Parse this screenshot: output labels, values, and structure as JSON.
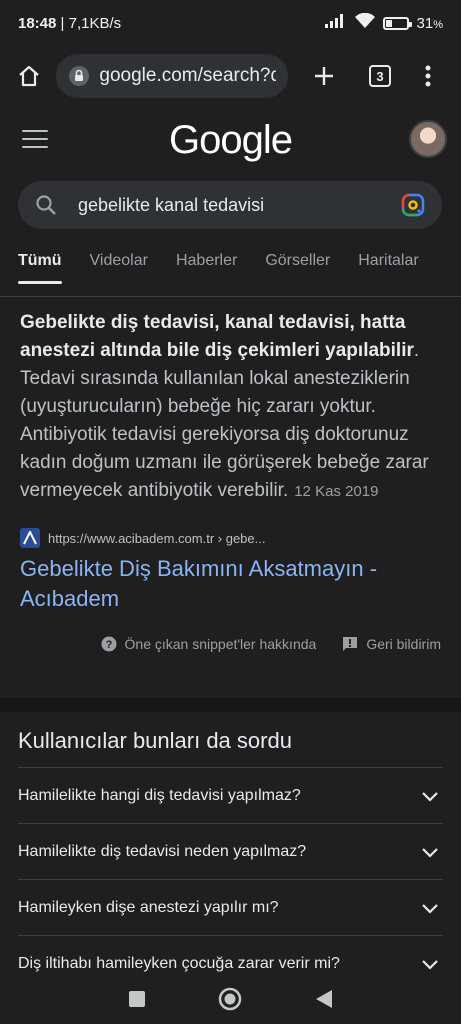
{
  "status_bar": {
    "time": "18:48",
    "speed": "7,1KB/s",
    "separator": " | ",
    "battery_text": "31",
    "battery_level_percent": 31,
    "battery_unit": "%"
  },
  "browser": {
    "url": "google.com/search?q",
    "tab_count": "3"
  },
  "google": {
    "logo_text": "Google"
  },
  "search": {
    "query": "gebelikte kanal tedavisi"
  },
  "filters": [
    {
      "label": "Tümü",
      "active": true
    },
    {
      "label": "Videolar",
      "active": false
    },
    {
      "label": "Haberler",
      "active": false
    },
    {
      "label": "Görseller",
      "active": false
    },
    {
      "label": "Haritalar",
      "active": false
    }
  ],
  "snippet": {
    "bold_text": "Gebelikte diş tedavisi, kanal tedavisi, hatta anestezi altında bile diş çekimleri yapılabilir",
    "body_text": ". Tedavi sırasında kullanılan lokal anesteziklerin (uyuşturucuların) bebeğe hiç zararı yoktur. Antibiyotik tedavisi gerekiyorsa diş doktorunuz kadın doğum uzmanı ile görüşerek bebeğe zarar vermeyecek antibiyotik verebilir.",
    "date": "12 Kas 2019",
    "source_url": "https://www.acibadem.com.tr › gebe...",
    "result_title": "Gebelikte Diş Bakımını Aksatmayın - Acıbadem",
    "about_label": "Öne çıkan snippet'ler hakkında",
    "feedback_label": "Geri bildirim"
  },
  "paa": {
    "title": "Kullanıcılar bunları da sordu",
    "questions": [
      "Hamilelikte hangi diş tedavisi yapılmaz?",
      "Hamilelikte diş tedavisi neden yapılmaz?",
      "Hamileyken dişe anestezi yapılır mı?",
      "Diş iltihabı hamileyken çocuğa zarar verir mi?"
    ]
  },
  "colors": {
    "background": "#1f1f1f",
    "link": "#8ab4f8",
    "text": "#e8eaed"
  }
}
